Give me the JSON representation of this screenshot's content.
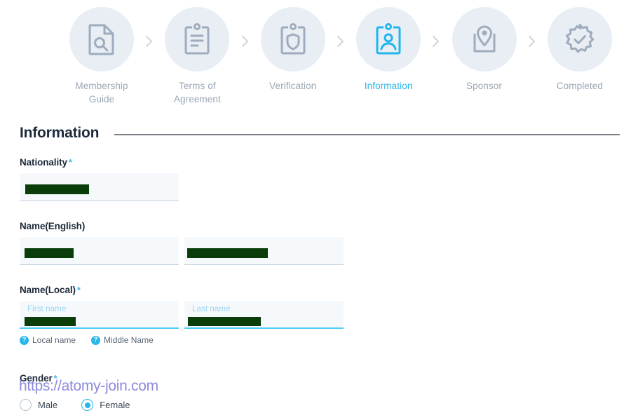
{
  "stepper": {
    "steps": [
      {
        "label": "Membership Guide",
        "icon": "document-search-icon",
        "active": false
      },
      {
        "label": "Terms of Agreement",
        "icon": "clipboard-list-icon",
        "active": false
      },
      {
        "label": "Verification",
        "icon": "clipboard-shield-icon",
        "active": false
      },
      {
        "label": "Information",
        "icon": "clipboard-person-icon",
        "active": true
      },
      {
        "label": "Sponsor",
        "icon": "map-pin-icon",
        "active": false
      },
      {
        "label": "Completed",
        "icon": "badge-check-icon",
        "active": false
      }
    ],
    "separator": "chevron-right-icon"
  },
  "section": {
    "title": "Information"
  },
  "form": {
    "nationality": {
      "label": "Nationality",
      "required": "*",
      "value": "",
      "placeholder": ""
    },
    "name_english": {
      "label": "Name(English)",
      "required": "",
      "first": {
        "value": "",
        "placeholder": ""
      },
      "last": {
        "value": "",
        "placeholder": ""
      }
    },
    "name_local": {
      "label": "Name(Local)",
      "required": "*",
      "first": {
        "value": "",
        "placeholder": "First name"
      },
      "last": {
        "value": "",
        "placeholder": "Last name"
      }
    },
    "helpers": [
      {
        "label": "Local name",
        "icon": "question-mark-icon"
      },
      {
        "label": "Middle Name",
        "icon": "question-mark-icon"
      }
    ],
    "gender": {
      "label": "Gender",
      "required": "*",
      "options": [
        {
          "label": "Male",
          "selected": false
        },
        {
          "label": "Female",
          "selected": true
        }
      ]
    }
  },
  "watermark": {
    "text": "https://atomy-join.com"
  },
  "colors": {
    "accent": "#29b6ea",
    "accent_light": "#4ecdf5",
    "inactive": "#9aa7b5",
    "circle_bg": "#e8eef3",
    "field_bg": "#f6f9fc",
    "title": "#1e2a3a",
    "rule": "#7b7f85",
    "redaction": "#0b3d0b",
    "watermark": "#8b8bdb"
  }
}
